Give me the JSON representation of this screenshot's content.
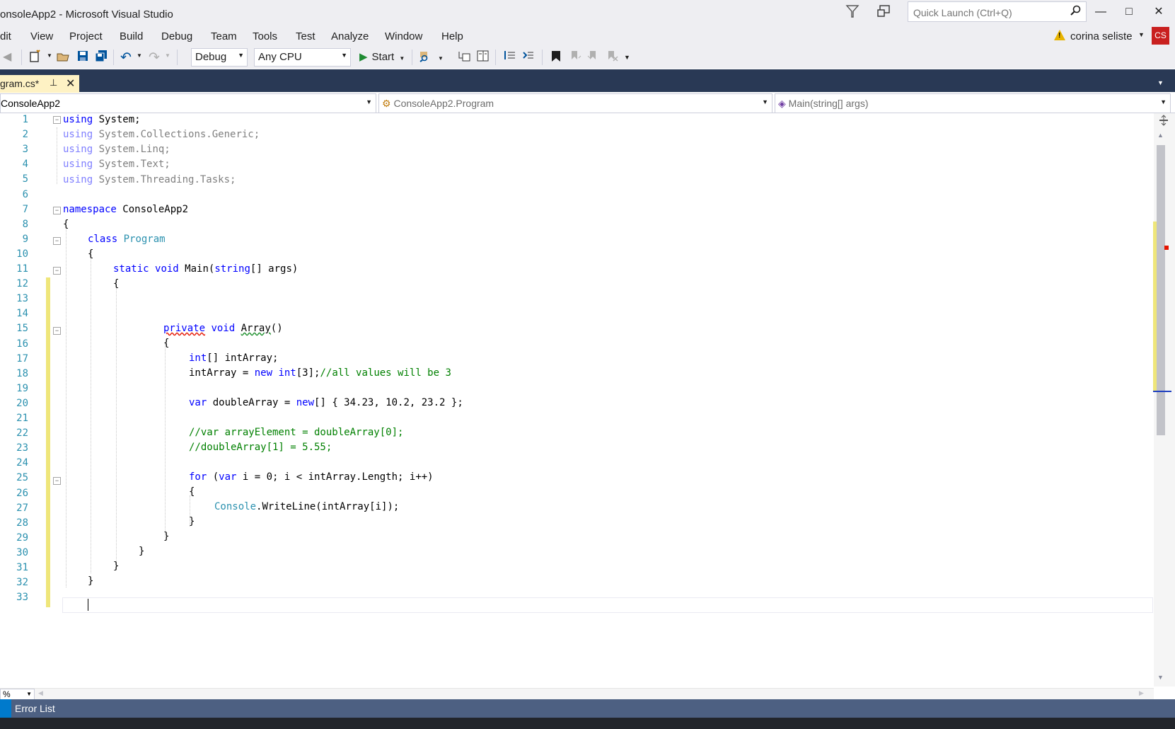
{
  "window": {
    "title": "onsoleApp2 - Microsoft Visual Studio",
    "quick_launch_placeholder": "Quick Launch (Ctrl+Q)",
    "min_glyph": "—",
    "max_glyph": "□",
    "close_glyph": "✕"
  },
  "menu": {
    "items": [
      "dit",
      "View",
      "Project",
      "Build",
      "Debug",
      "Team",
      "Tools",
      "Test",
      "Analyze",
      "Window",
      "Help"
    ],
    "user_name": "corina seliste",
    "user_initials": "CS"
  },
  "toolbar": {
    "config": "Debug",
    "platform": "Any CPU",
    "start_label": "Start"
  },
  "tab": {
    "label": "gram.cs*",
    "pin_glyph": "⊥",
    "close_glyph": "✕"
  },
  "navigation": {
    "project": "ConsoleApp2",
    "type": "ConsoleApp2.Program",
    "member": "Main(string[] args)"
  },
  "code": {
    "line_numbers": [
      "1",
      "2",
      "3",
      "4",
      "5",
      "6",
      "7",
      "8",
      "9",
      "10",
      "11",
      "12",
      "13",
      "14",
      "15",
      "16",
      "17",
      "18",
      "19",
      "20",
      "21",
      "22",
      "23",
      "24",
      "25",
      "26",
      "27",
      "28",
      "29",
      "30",
      "31",
      "32",
      "33"
    ],
    "l1_kw": "using",
    "l1_rest": " System;",
    "l2_kw": "using",
    "l2_rest": " System.Collections.Generic;",
    "l3_kw": "using",
    "l3_rest": " System.Linq;",
    "l4_kw": "using",
    "l4_rest": " System.Text;",
    "l5_kw": "using",
    "l5_rest": " System.Threading.Tasks;",
    "l7_kw": "namespace",
    "l7_rest": " ConsoleApp2",
    "l8": "{",
    "l9_kw": "class",
    "l9_type": "Program",
    "l10": "{",
    "l11_kw1": "static",
    "l11_kw2": "void",
    "l11_name": " Main(",
    "l11_kw3": "string",
    "l11_rest": "[] args)",
    "l12": "{",
    "l15_kw1": "private",
    "l15_kw2": "void",
    "l15_name": "Array",
    "l15_rest": "()",
    "l16": "{",
    "l17_kw": "int",
    "l17_rest": "[] intArray;",
    "l18_a": "intArray = ",
    "l18_kw1": "new",
    "l18_kw2": "int",
    "l18_b": "[3];",
    "l18_cm": "//all values will be 3",
    "l20_kw1": "var",
    "l20_a": " doubleArray = ",
    "l20_kw2": "new",
    "l20_b": "[] { 34.23, 10.2, 23.2 };",
    "l22_cm": "//var arrayElement = doubleArray[0];",
    "l23_cm": "//doubleArray[1] = 5.55;",
    "l25_kw1": "for",
    "l25_a": " (",
    "l25_kw2": "var",
    "l25_b": " i = 0; i < intArray.Length; i++)",
    "l26": "{",
    "l27_type": "Console",
    "l27_rest": ".WriteLine(intArray[i]);",
    "l28": "}",
    "l29": "}",
    "l30": "}",
    "l31": "}",
    "l32": "}"
  },
  "status": {
    "zoom": "%",
    "error_list": "Error List"
  }
}
